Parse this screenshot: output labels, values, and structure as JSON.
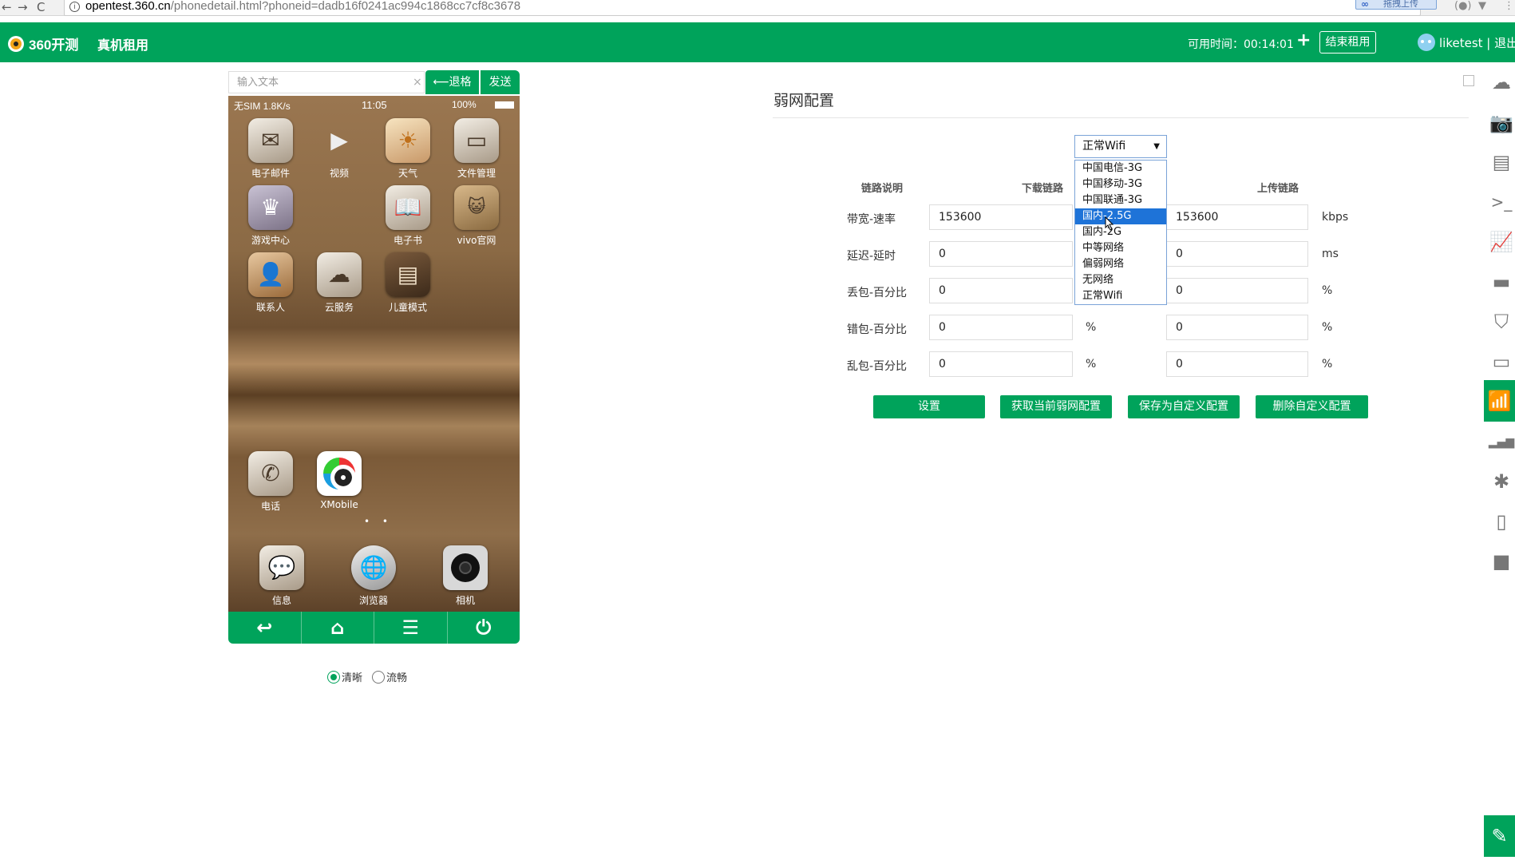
{
  "browser": {
    "back": "←",
    "forward": "→",
    "reload": "C",
    "url_host": "opentest.360.cn",
    "url_path": "/phonedetail.html?phoneid=dadb16f0241ac994c1868cc7cf8c3678",
    "extension_label": "拖拽上传",
    "ext_icons": [
      "(●)",
      "▼",
      "⋮"
    ]
  },
  "header": {
    "logo": "360开测",
    "nav_rent": "真机租用",
    "available_time": "可用时间：00:14:01",
    "add_time": "+",
    "end_rent": "结束租用",
    "user": "liketest | 退出"
  },
  "phone_controls": {
    "input_placeholder": "输入文本",
    "clear": "×",
    "back_label": "⟵退格",
    "send_label": "发送"
  },
  "phone": {
    "status_left": "无SIM 1.8K/s",
    "status_time": "11:05",
    "status_right": "100%",
    "apps": [
      {
        "label": "电子邮件",
        "icon": "mail-icon"
      },
      {
        "label": "视频",
        "icon": "video-icon"
      },
      {
        "label": "天气",
        "icon": "weather-icon"
      },
      {
        "label": "文件管理",
        "icon": "file-manager-icon"
      },
      {
        "label": "游戏中心",
        "icon": "game-center-icon"
      },
      {
        "label": "电子书",
        "icon": "ebook-icon"
      },
      {
        "label": "vivo官网",
        "icon": "vivo-icon"
      },
      {
        "label": "联系人",
        "icon": "contacts-icon"
      },
      {
        "label": "云服务",
        "icon": "cloud-icon"
      },
      {
        "label": "儿童模式",
        "icon": "kids-mode-icon"
      },
      {
        "label": "电话",
        "icon": "phone-icon"
      },
      {
        "label": "XMobile",
        "icon": "xmobile-icon"
      },
      {
        "label": "信息",
        "icon": "messages-icon"
      },
      {
        "label": "浏览器",
        "icon": "browser-icon"
      },
      {
        "label": "相机",
        "icon": "camera-icon"
      }
    ],
    "page_dots": "• •"
  },
  "phone_nav": [
    "↩",
    "⌂",
    "☰",
    "⏻"
  ],
  "quality": {
    "clear": "清晰",
    "smooth": "流畅",
    "selected": "clear"
  },
  "panel": {
    "title": "弱网配置",
    "select_value": "正常Wifi",
    "options": [
      "中国电信-3G",
      "中国移动-3G",
      "中国联通-3G",
      "国内-2.5G",
      "国内-2G",
      "中等网络",
      "偏弱网络",
      "无网络",
      "正常Wifi"
    ],
    "highlighted_option": "国内-2.5G",
    "col_link": "链路说明",
    "col_down": "下载链路",
    "col_up": "上传链路",
    "rows": [
      {
        "label": "带宽-速率",
        "down": "153600",
        "down_unit": "",
        "up": "153600",
        "up_unit": "kbps"
      },
      {
        "label": "延迟-延时",
        "down": "0",
        "down_unit": "",
        "up": "0",
        "up_unit": "ms"
      },
      {
        "label": "丢包-百分比",
        "down": "0",
        "down_unit": "",
        "up": "0",
        "up_unit": "%"
      },
      {
        "label": "错包-百分比",
        "down": "0",
        "down_unit": "%",
        "up": "0",
        "up_unit": "%"
      },
      {
        "label": "乱包-百分比",
        "down": "0",
        "down_unit": "%",
        "up": "0",
        "up_unit": "%"
      }
    ],
    "buttons": [
      "设置",
      "获取当前弱网配置",
      "保存为自定义配置",
      "删除自定义配置"
    ]
  },
  "sidebar_icons": [
    "cloud-upload-icon",
    "camera-icon",
    "document-icon",
    "terminal-icon",
    "chart-icon",
    "folder-icon",
    "html5-icon",
    "battery-icon",
    "wifi-icon",
    "signal-icon",
    "bug-icon",
    "mobile-icon",
    "video-camera-icon"
  ],
  "sidebar_glyphs": [
    "☁",
    "📷",
    "▤",
    ">_",
    "📈",
    "▬",
    "⛉",
    "▭",
    "📶",
    "▂▄▆",
    "✱",
    "▯",
    "■"
  ],
  "active_sidebar": "wifi-icon",
  "colors": {
    "brand_green": "#00a35b",
    "select_blue": "#1e73d8"
  }
}
